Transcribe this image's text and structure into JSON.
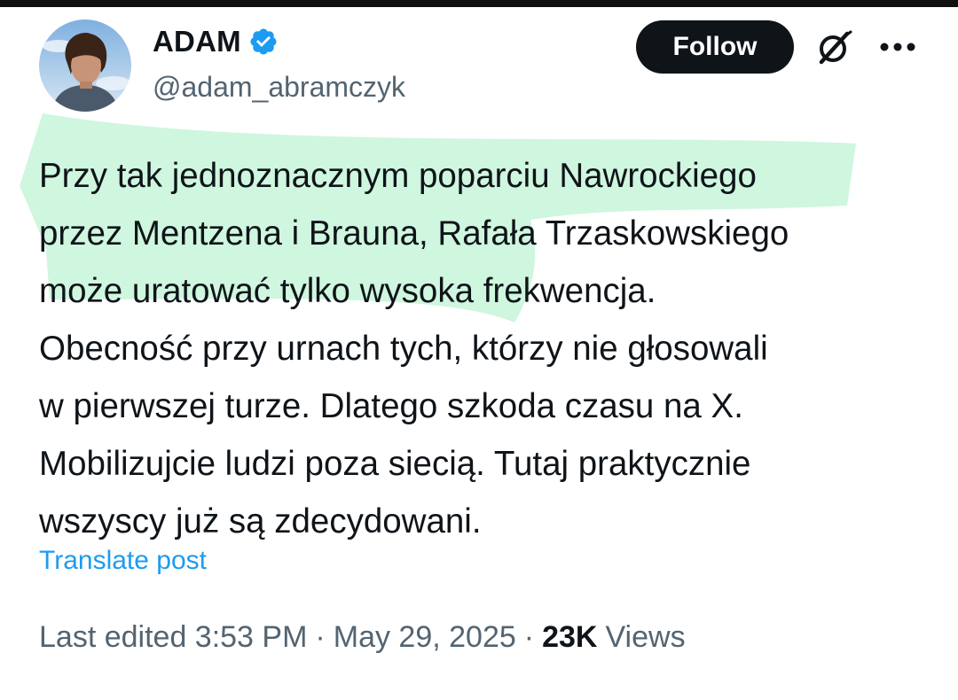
{
  "author": {
    "display_name": "ADAM",
    "handle": "@adam_abramczyk",
    "verified_icon": "verified-badge-icon",
    "avatar_icon": "profile-photo"
  },
  "actions": {
    "follow_label": "Follow",
    "grok_icon": "grok-icon",
    "more_icon": "more-dots-icon"
  },
  "tweet": {
    "lines": [
      "Przy tak jednoznacznym poparciu Nawrockiego",
      "przez Mentzena i Brauna,  Rafała Trzaskowskiego",
      "może uratować tylko wysoka frekwencja.",
      "Obecność przy urnach tych, którzy nie głosowali",
      "w pierwszej turze. Dlatego szkoda czasu na X.",
      "Mobilizujcie ludzi poza siecią. Tutaj praktycznie",
      "wszyscy już są zdecydowani."
    ]
  },
  "translate_label": "Translate post",
  "meta": {
    "edited_time": "Last edited 3:53 PM",
    "separator": "·",
    "date": "May 29, 2025",
    "views_count": "23K",
    "views_label": "Views"
  },
  "colors": {
    "text": "#0f1419",
    "secondary": "#536471",
    "link": "#1d9bf0",
    "verified": "#1d9bf0",
    "highlight": "#a8eec4",
    "follow_bg": "#0f1419"
  }
}
